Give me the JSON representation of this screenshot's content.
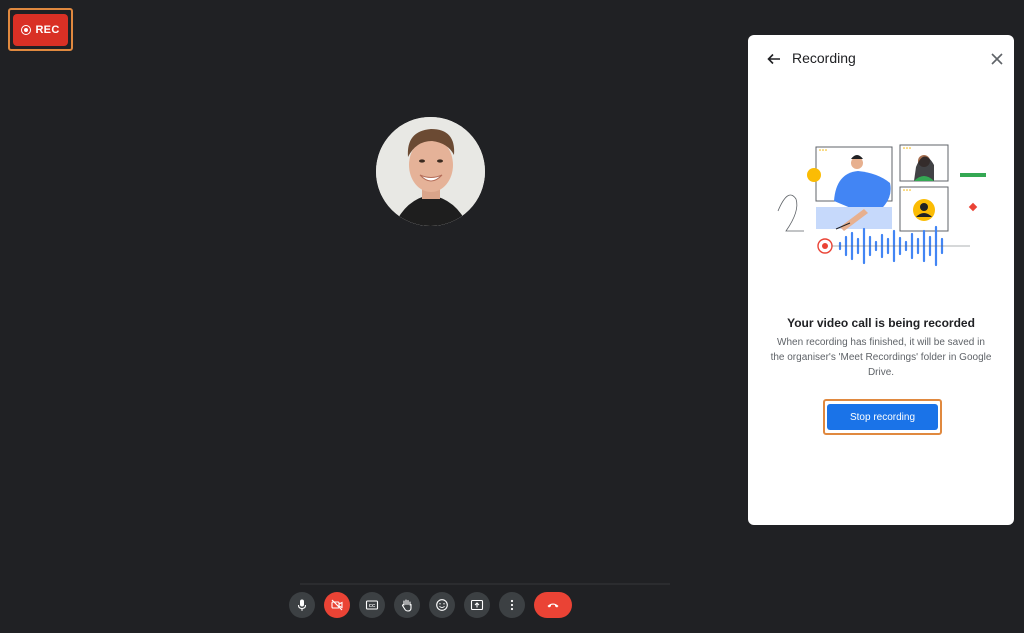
{
  "recording_badge": {
    "label": "REC"
  },
  "panel": {
    "title": "Recording",
    "message_title": "Your video call is being recorded",
    "message_body": "When recording has finished, it will be saved in the organiser's 'Meet Recordings' folder in Google Drive.",
    "stop_button_label": "Stop recording"
  },
  "toolbar": {
    "buttons": [
      {
        "icon": "microphone-icon"
      },
      {
        "icon": "camera-off-icon",
        "state": "off"
      },
      {
        "icon": "captions-icon"
      },
      {
        "icon": "raise-hand-icon"
      },
      {
        "icon": "emoji-icon"
      },
      {
        "icon": "present-screen-icon"
      },
      {
        "icon": "more-options-icon"
      },
      {
        "icon": "end-call-icon"
      }
    ]
  },
  "colors": {
    "background": "#202124",
    "rec_red": "#d93025",
    "primary_blue": "#1a73e8",
    "highlight_orange": "#e0893f"
  }
}
